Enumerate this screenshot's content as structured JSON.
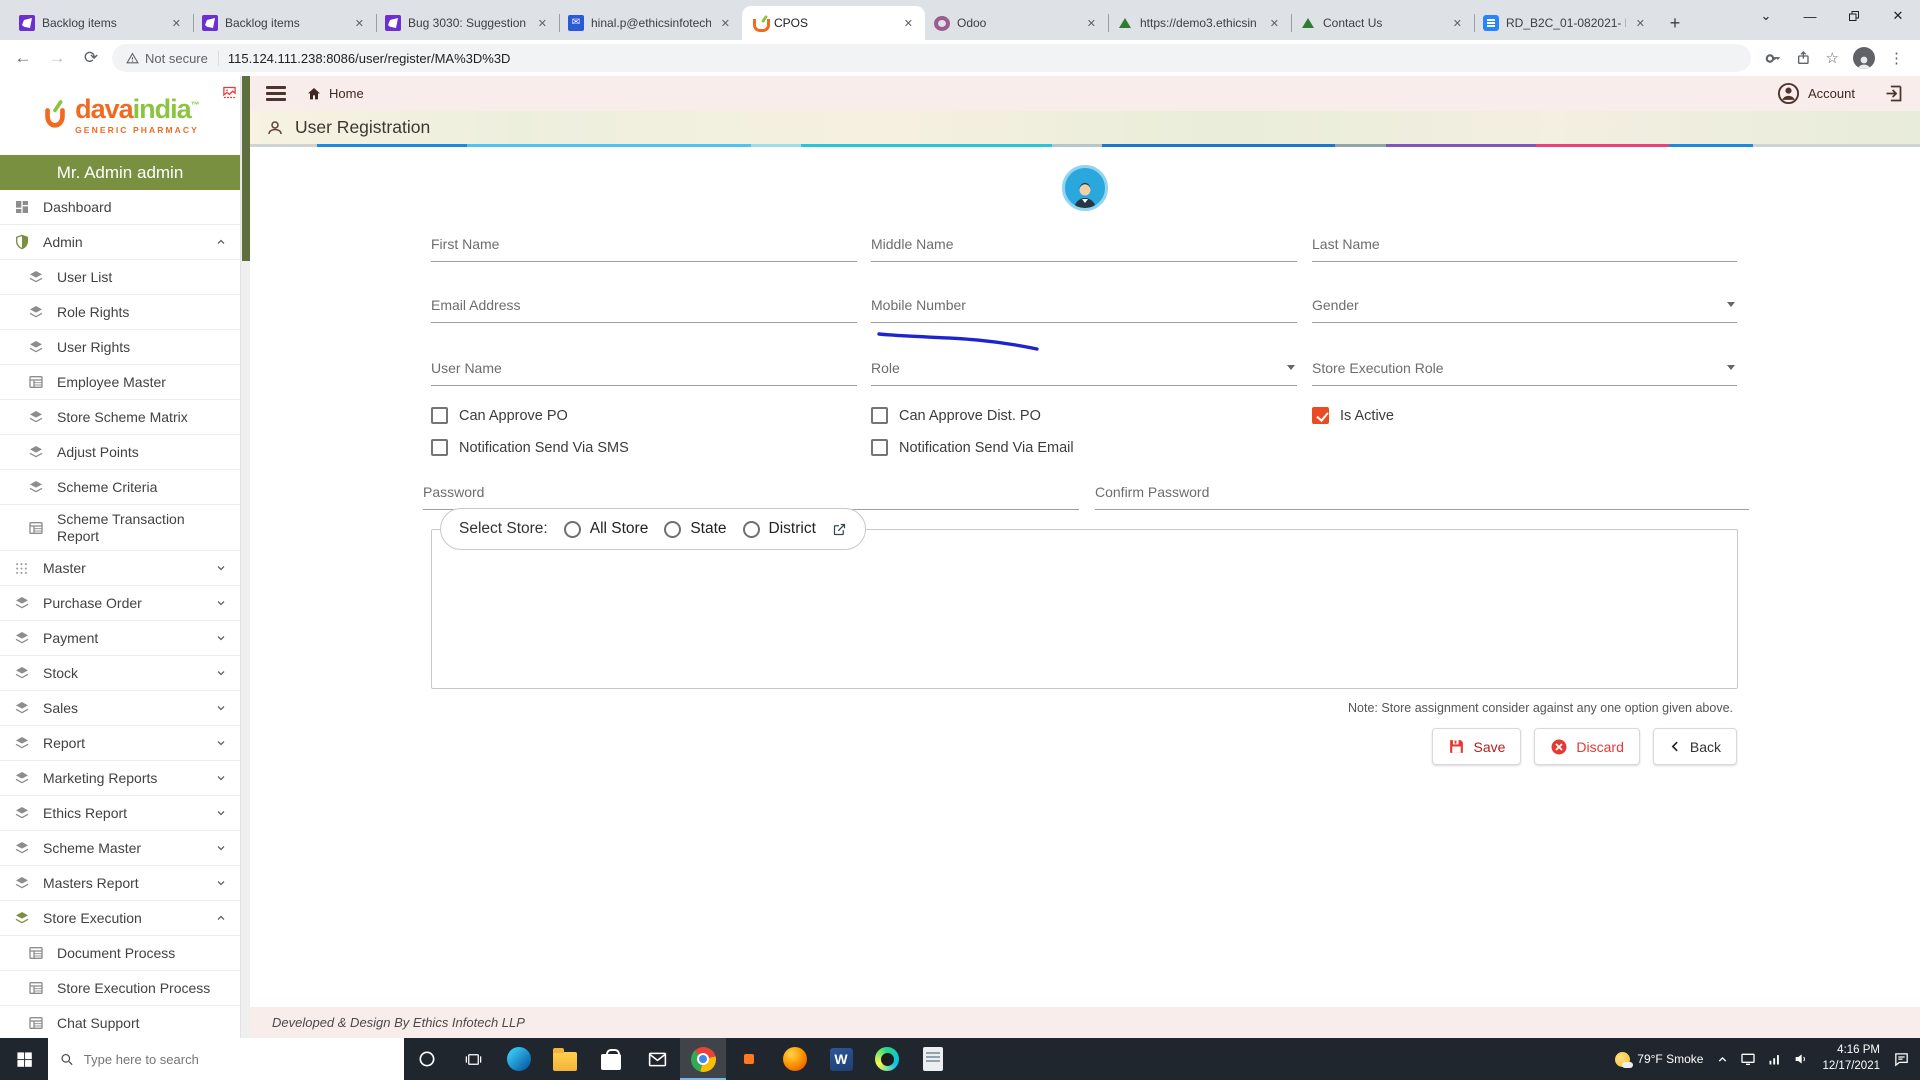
{
  "browser": {
    "tabs": [
      {
        "title": "Backlog items"
      },
      {
        "title": "Backlog items"
      },
      {
        "title": "Bug 3030: Suggestion"
      },
      {
        "title": "hinal.p@ethicsinfotech"
      },
      {
        "title": "CPOS"
      },
      {
        "title": "Odoo"
      },
      {
        "title": "https://demo3.ethicsin"
      },
      {
        "title": "Contact Us"
      },
      {
        "title": "RD_B2C_01-082021- B"
      }
    ],
    "toolbar": {
      "security_label": "Not secure",
      "url": "115.124.111.238:8086/user/register/MA%3D%3D"
    }
  },
  "sidebar": {
    "logo": {
      "brand_left": "dava",
      "brand_right": "india",
      "trademark": "™",
      "tagline": "GENERIC PHARMACY"
    },
    "user_name": "Mr. Admin admin",
    "items": [
      {
        "label": "Dashboard"
      },
      {
        "label": "Admin"
      },
      {
        "label": "User List"
      },
      {
        "label": "Role Rights"
      },
      {
        "label": "User Rights"
      },
      {
        "label": "Employee Master"
      },
      {
        "label": "Store Scheme Matrix"
      },
      {
        "label": "Adjust Points"
      },
      {
        "label": "Scheme Criteria"
      },
      {
        "label": "Scheme Transaction Report"
      },
      {
        "label": "Master"
      },
      {
        "label": "Purchase Order"
      },
      {
        "label": "Payment"
      },
      {
        "label": "Stock"
      },
      {
        "label": "Sales"
      },
      {
        "label": "Report"
      },
      {
        "label": "Marketing Reports"
      },
      {
        "label": "Ethics Report"
      },
      {
        "label": "Scheme Master"
      },
      {
        "label": "Masters Report"
      },
      {
        "label": "Store Execution"
      },
      {
        "label": "Document Process"
      },
      {
        "label": "Store Execution Process"
      },
      {
        "label": "Chat Support"
      }
    ]
  },
  "topbar": {
    "home_label": "Home",
    "account_label": "Account"
  },
  "page": {
    "title": "User Registration",
    "fields": {
      "first_name": "First Name",
      "middle_name": "Middle Name",
      "last_name": "Last Name",
      "email": "Email Address",
      "mobile": "Mobile Number",
      "gender": "Gender",
      "user_name": "User Name",
      "role": "Role",
      "store_exec_role": "Store Execution Role",
      "password": "Password",
      "confirm_password": "Confirm Password"
    },
    "checkboxes": {
      "can_approve_po": {
        "label": "Can Approve PO",
        "checked": false
      },
      "can_approve_dist_po": {
        "label": "Can Approve Dist. PO",
        "checked": false
      },
      "is_active": {
        "label": "Is Active",
        "checked": true
      },
      "sms": {
        "label": "Notification Send Via SMS",
        "checked": false
      },
      "email_notif": {
        "label": "Notification Send Via Email",
        "checked": false
      }
    },
    "store": {
      "legend": "Select Store:",
      "options": [
        "All Store",
        "State",
        "District"
      ]
    },
    "note": "Note: Store assignment consider against any one option given above.",
    "buttons": {
      "save": "Save",
      "discard": "Discard",
      "back": "Back"
    },
    "footer": "Developed & Design By Ethics Infotech LLP"
  },
  "taskbar": {
    "search_placeholder": "Type here to search",
    "weather": "79°F Smoke",
    "time": "4:16 PM",
    "date": "12/17/2021"
  },
  "colors": {
    "sidebar_userbar_green": "#78903f",
    "brand_orange": "#f26a21",
    "brand_green": "#8bc53f",
    "active_checkbox_red": "#ea4b23",
    "scribble_blue": "#1d24cf",
    "topbar_pink": "#f9edeb"
  }
}
